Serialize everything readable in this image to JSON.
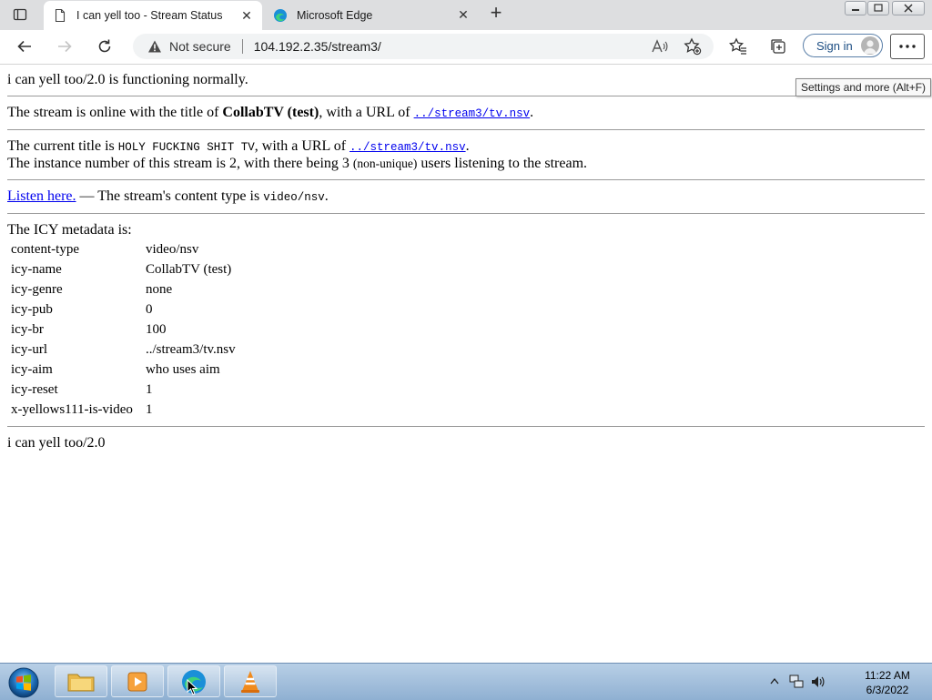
{
  "browser": {
    "tabs": [
      {
        "title": "I can yell too - Stream Status",
        "active": true
      },
      {
        "title": "Microsoft Edge",
        "active": false
      }
    ],
    "address": {
      "security": "Not secure",
      "url": "104.192.2.35/stream3/"
    },
    "signin_label": "Sign in",
    "tooltip": "Settings and more (Alt+F)",
    "accent_color": "#0078d4"
  },
  "page": {
    "status_line": "i can yell too/2.0 is functioning normally.",
    "online": {
      "prefix": "The stream is online with the title of ",
      "title": "CollabTV (test)",
      "mid": ", with a URL of ",
      "url": "../stream3/tv.nsv",
      "suffix": "."
    },
    "current": {
      "prefix": "The current title is ",
      "title": "HOLY FUCKING SHIT TV",
      "mid": ", with a URL of ",
      "url": "../stream3/tv.nsv",
      "suffix": "."
    },
    "instance": {
      "prefix": "The instance number of this stream is 2, with there being 3 ",
      "note": "(non-unique)",
      "suffix": " users listening to the stream."
    },
    "listen": {
      "link": "Listen here.",
      "text": " — The stream's content type is ",
      "type": "video/nsv",
      "suffix": "."
    },
    "metadata_heading": "The ICY metadata is:",
    "metadata": [
      {
        "key": "content-type",
        "value": "video/nsv"
      },
      {
        "key": "icy-name",
        "value": "CollabTV (test)"
      },
      {
        "key": "icy-genre",
        "value": "none"
      },
      {
        "key": "icy-pub",
        "value": "0"
      },
      {
        "key": "icy-br",
        "value": "100"
      },
      {
        "key": "icy-url",
        "value": "../stream3/tv.nsv"
      },
      {
        "key": "icy-aim",
        "value": "who uses aim"
      },
      {
        "key": "icy-reset",
        "value": "1"
      },
      {
        "key": "x-yellows111-is-video",
        "value": "1"
      }
    ],
    "footer": "i can yell too/2.0"
  },
  "taskbar": {
    "time": "11:22 AM",
    "date": "6/3/2022",
    "apps": [
      "file-explorer",
      "media-player",
      "microsoft-edge",
      "vlc"
    ]
  }
}
